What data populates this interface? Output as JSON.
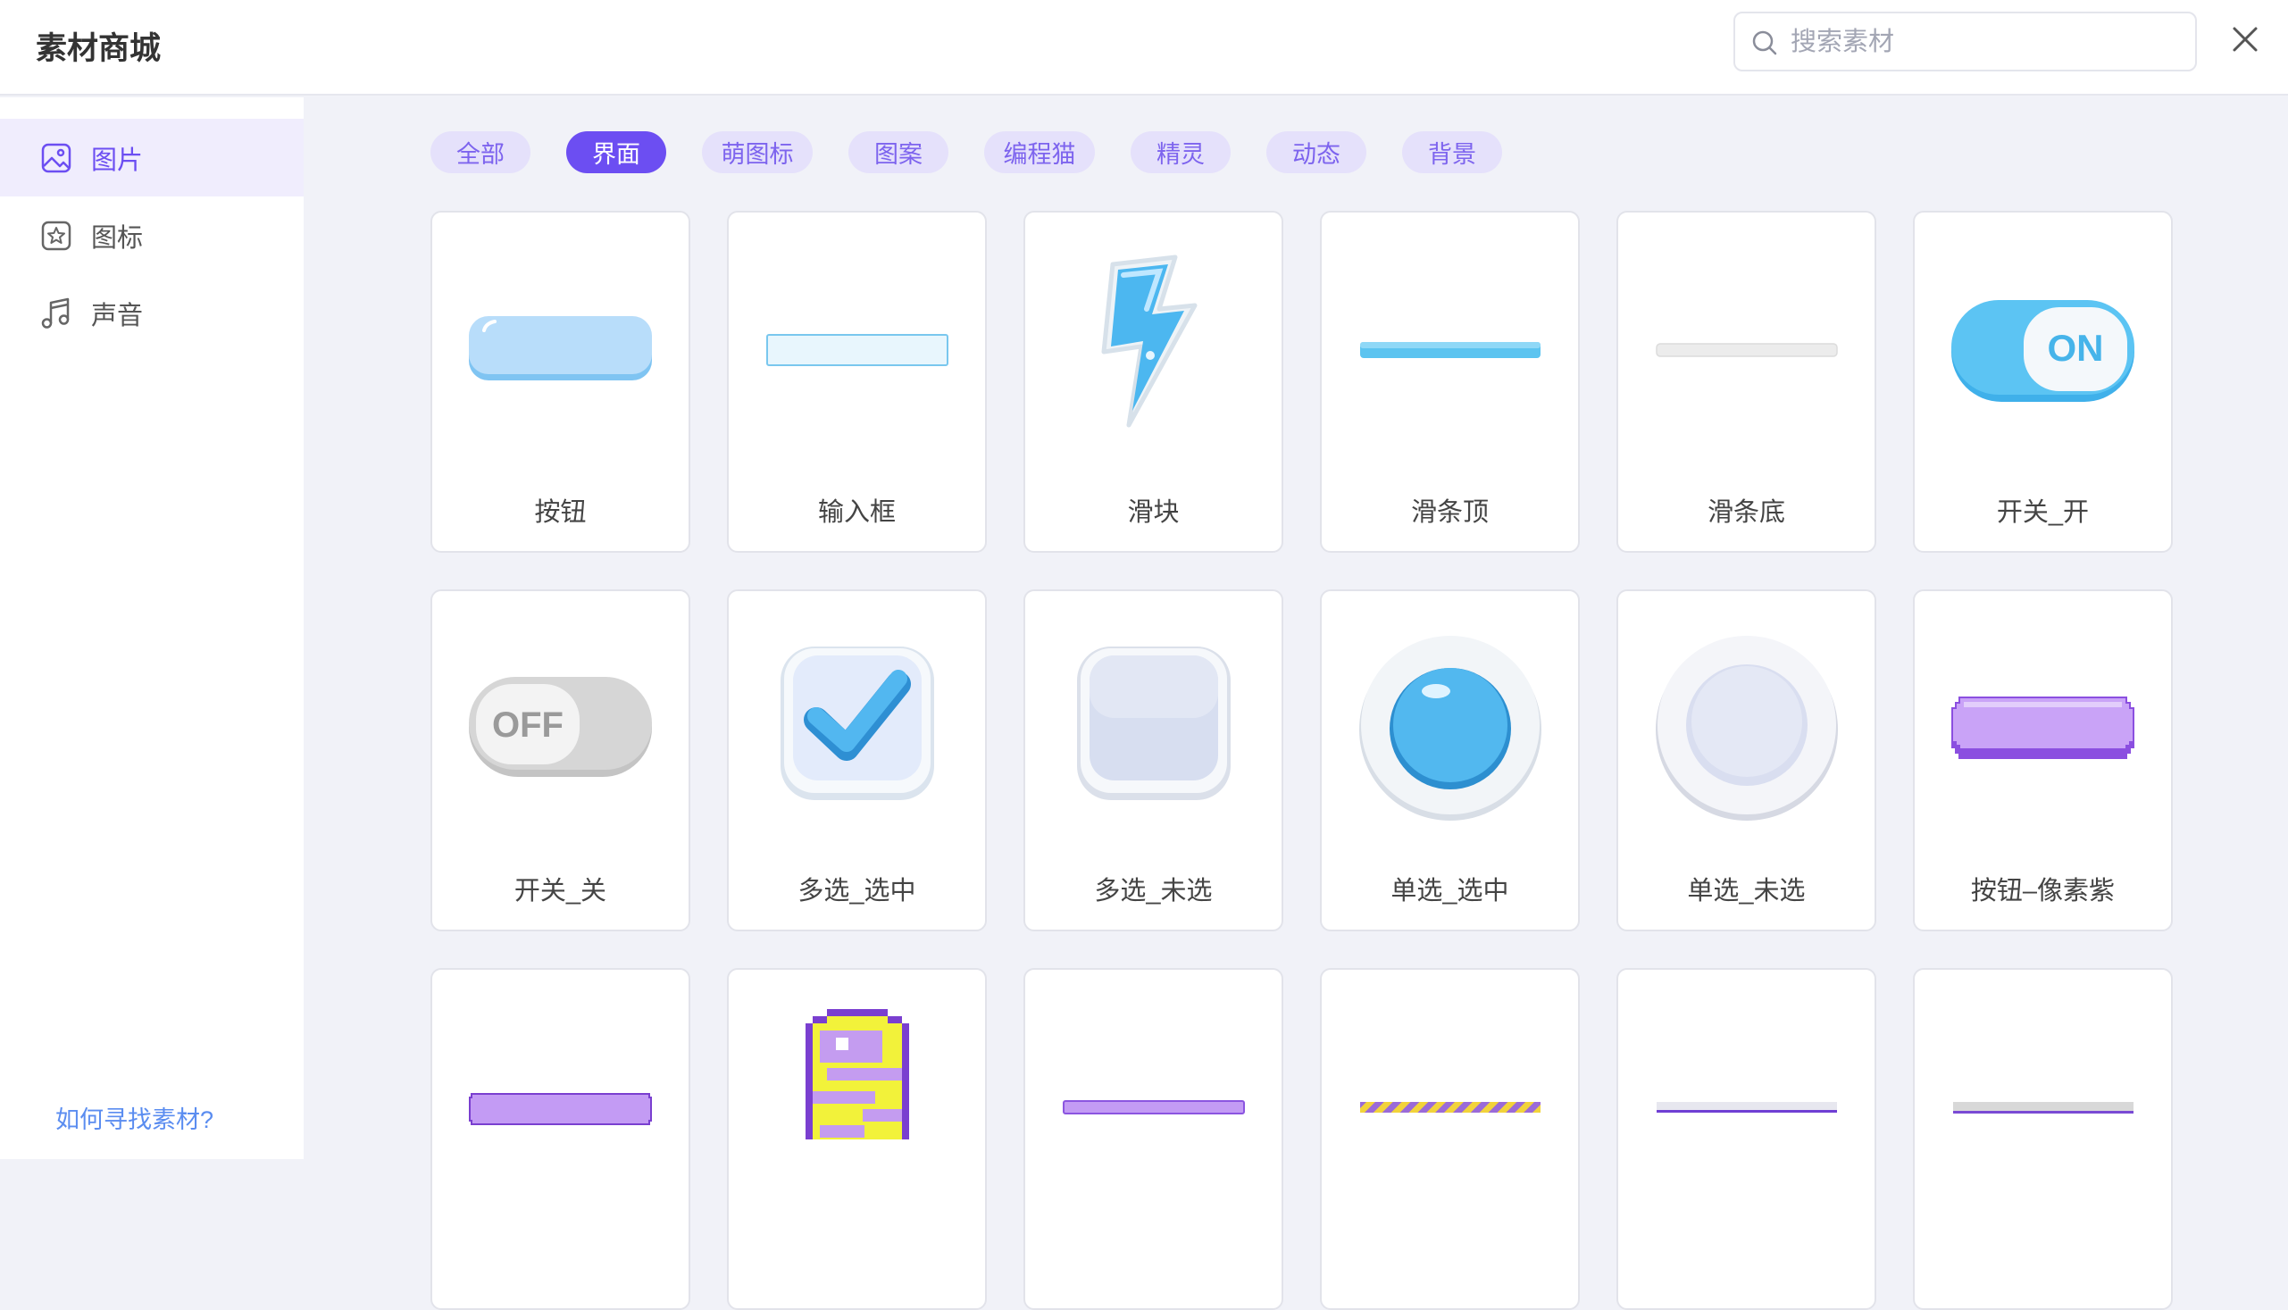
{
  "header": {
    "title": "素材商城",
    "search_placeholder": "搜索素材"
  },
  "sidebar": {
    "items": [
      {
        "label": "图片",
        "icon": "image-icon",
        "active": true
      },
      {
        "label": "图标",
        "icon": "star-icon",
        "active": false
      },
      {
        "label": "声音",
        "icon": "music-icon",
        "active": false
      }
    ],
    "help": "如何寻找素材?"
  },
  "tabs": [
    {
      "label": "全部",
      "active": false
    },
    {
      "label": "界面",
      "active": true
    },
    {
      "label": "萌图标",
      "active": false
    },
    {
      "label": "图案",
      "active": false
    },
    {
      "label": "编程猫",
      "active": false
    },
    {
      "label": "精灵",
      "active": false
    },
    {
      "label": "动态",
      "active": false
    },
    {
      "label": "背景",
      "active": false
    }
  ],
  "assets": [
    {
      "label": "按钮",
      "icon": "button-thumbnail"
    },
    {
      "label": "输入框",
      "icon": "input-box-thumbnail"
    },
    {
      "label": "滑块",
      "icon": "lightning-slider-thumbnail"
    },
    {
      "label": "滑条顶",
      "icon": "slider-top-thumbnail"
    },
    {
      "label": "滑条底",
      "icon": "slider-bottom-thumbnail"
    },
    {
      "label": "开关_开",
      "icon": "switch-on-thumbnail",
      "text": "ON"
    },
    {
      "label": "开关_关",
      "icon": "switch-off-thumbnail",
      "text": "OFF"
    },
    {
      "label": "多选_选中",
      "icon": "checkbox-checked-thumbnail"
    },
    {
      "label": "多选_未选",
      "icon": "checkbox-unchecked-thumbnail"
    },
    {
      "label": "单选_选中",
      "icon": "radio-checked-thumbnail"
    },
    {
      "label": "单选_未选",
      "icon": "radio-unchecked-thumbnail"
    },
    {
      "label": "按钮–像素紫",
      "icon": "pixel-purple-button-thumbnail"
    },
    {
      "label": "",
      "icon": "pixel-purple-bar-thumbnail"
    },
    {
      "label": "",
      "icon": "pixel-lollipop-thumbnail"
    },
    {
      "label": "",
      "icon": "purple-slider-thumbnail"
    },
    {
      "label": "",
      "icon": "striped-slider-thumbnail"
    },
    {
      "label": "",
      "icon": "thin-purple-slider-thumbnail"
    },
    {
      "label": "",
      "icon": "gray-slider-thumbnail"
    }
  ],
  "colors": {
    "accent": "#6c4ef2",
    "tab_bg": "#e5e1fb",
    "page_bg": "#f1f2f8",
    "link": "#5b8df0"
  }
}
